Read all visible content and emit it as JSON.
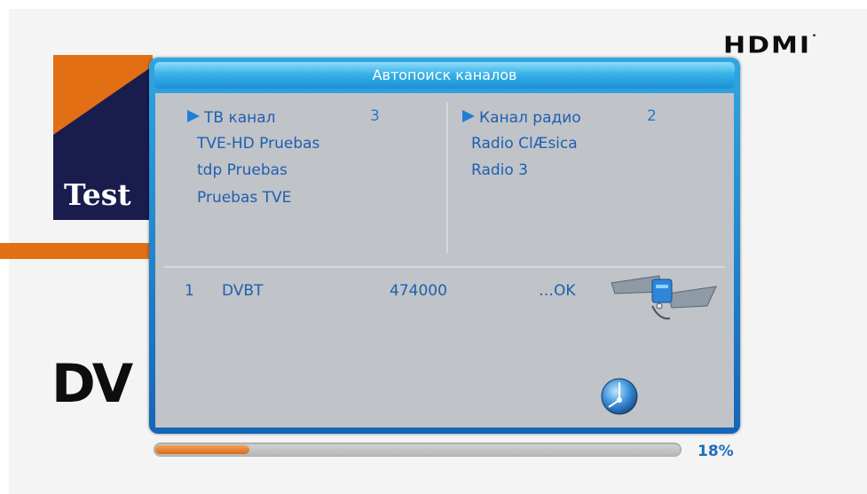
{
  "background": {
    "hdmi_logo": "HDMI",
    "brand_partial_text": "Test",
    "dv_partial_text": "DV"
  },
  "dialog": {
    "title": "Автопоиск каналов",
    "tv": {
      "header": "ТВ канал",
      "count": "3",
      "channels": [
        "TVE-HD Pruebas",
        "tdp Pruebas",
        "Pruebas TVE"
      ]
    },
    "radio": {
      "header": "Канал радио",
      "count": "2",
      "channels": [
        "Radio ClÆsica",
        "Radio 3"
      ]
    },
    "scan_row": {
      "index": "1",
      "type": "DVBT",
      "frequency": "474000",
      "status": "…OK"
    }
  },
  "progress": {
    "percent_label": "18%",
    "value": 0.18
  },
  "colors": {
    "dialog_frame": "#1f7fd0",
    "panel_bg": "#c0c3c8",
    "text_blue": "#1f5fb0",
    "progress_fill": "#e07a25"
  },
  "icons": [
    "satellite-icon",
    "globe-icon",
    "arrow-right-icon"
  ]
}
